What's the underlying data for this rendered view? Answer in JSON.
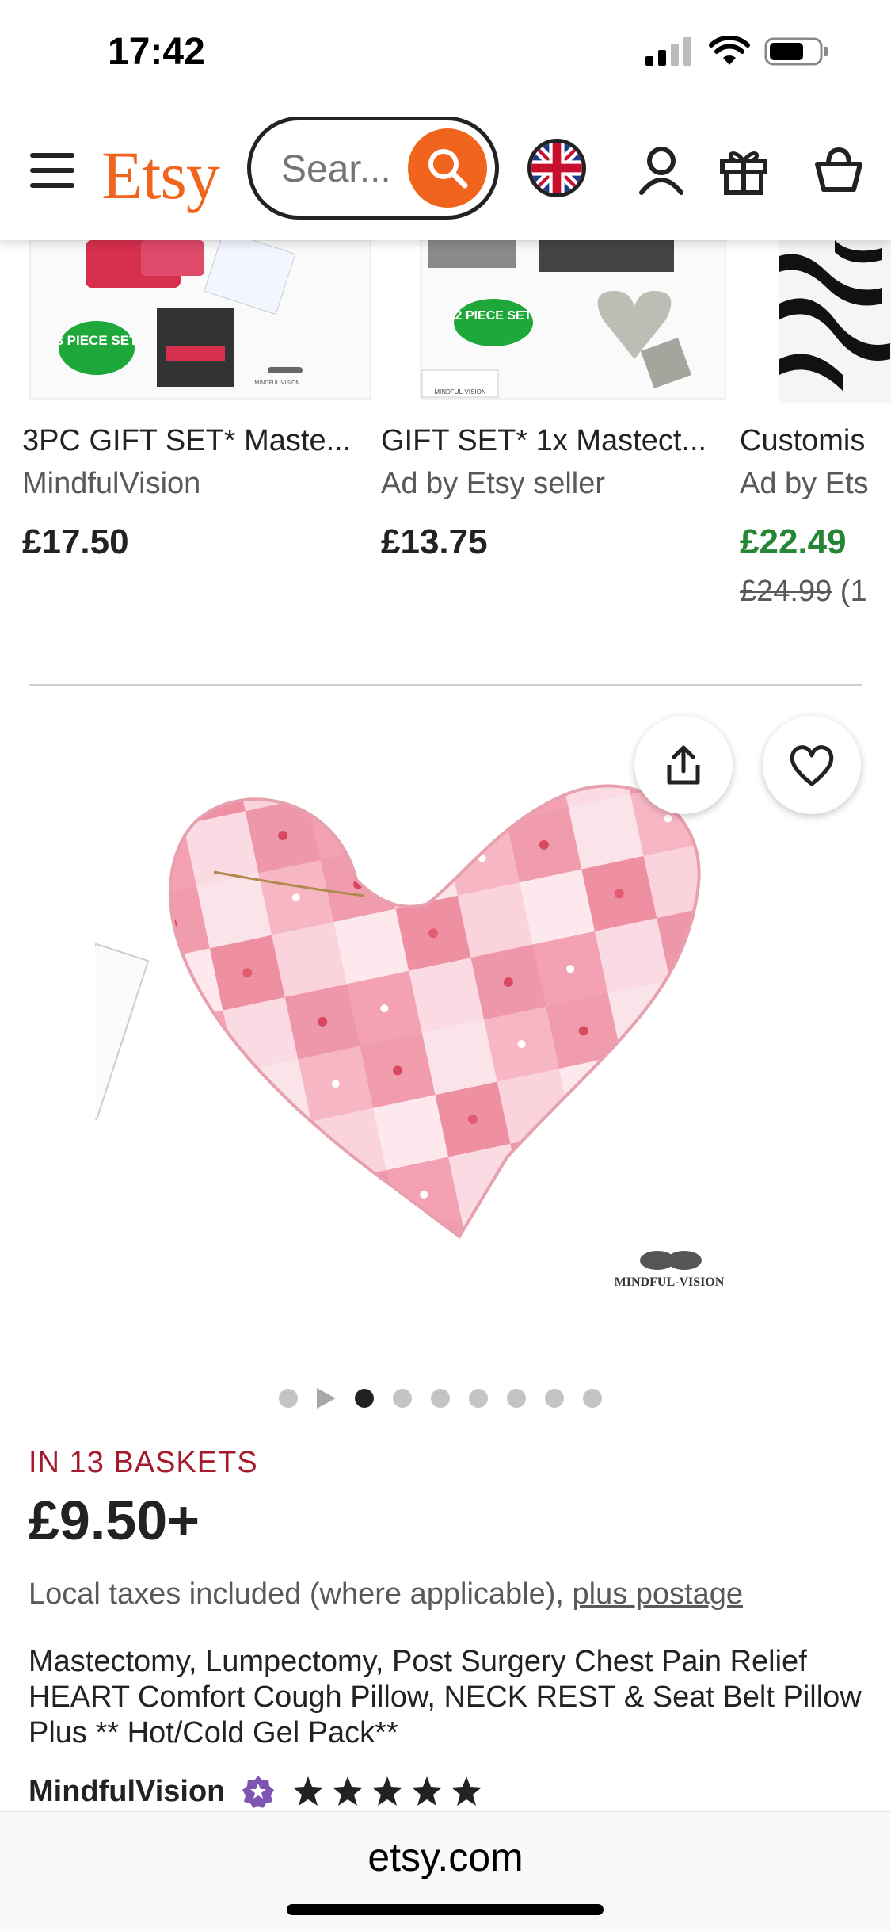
{
  "status_bar": {
    "time": "17:42"
  },
  "header": {
    "logo": "Etsy",
    "search_placeholder": "Sear...",
    "icons": [
      "menu-icon",
      "search-icon",
      "uk-flag-icon",
      "account-icon",
      "gift-icon",
      "basket-icon"
    ]
  },
  "recommendations": [
    {
      "title": "3PC GIFT SET* Maste...",
      "shop": "MindfulVision",
      "price": "£17.50",
      "badge": "3 PIECE SET",
      "watermark": "MINDFUL-VISION",
      "sale": false
    },
    {
      "title": "GIFT SET* 1x Mastect...",
      "shop": "Ad by Etsy seller",
      "price": "£13.75",
      "badge": "2 PIECE SET",
      "watermark": "MINDFUL-VISION",
      "sale": false
    },
    {
      "title": "Customis",
      "shop": "Ad by Ets",
      "price": "£22.49",
      "original_price": "£24.99",
      "original_suffix": "(1",
      "sale": true
    }
  ],
  "listing": {
    "image_watermark": "MINDFUL-VISION",
    "image_count": 8,
    "active_image_index": 0,
    "baskets": "IN 13 BASKETS",
    "price": "£9.50+",
    "tax_text": "Local taxes included (where applicable),",
    "postage_link": "plus postage",
    "title": "Mastectomy, Lumpectomy, Post Surgery Chest Pain Relief HEART Comfort Cough Pillow, NECK REST & Seat Belt Pillow Plus ** Hot/Cold Gel Pack**",
    "shop_name": "MindfulVision",
    "rating_stars": 5
  },
  "browser": {
    "url": "etsy.com"
  },
  "colors": {
    "brand": "#f1641e",
    "sale": "#258635",
    "baskets": "#a61a2e",
    "star_seller": "#7f54b3"
  }
}
